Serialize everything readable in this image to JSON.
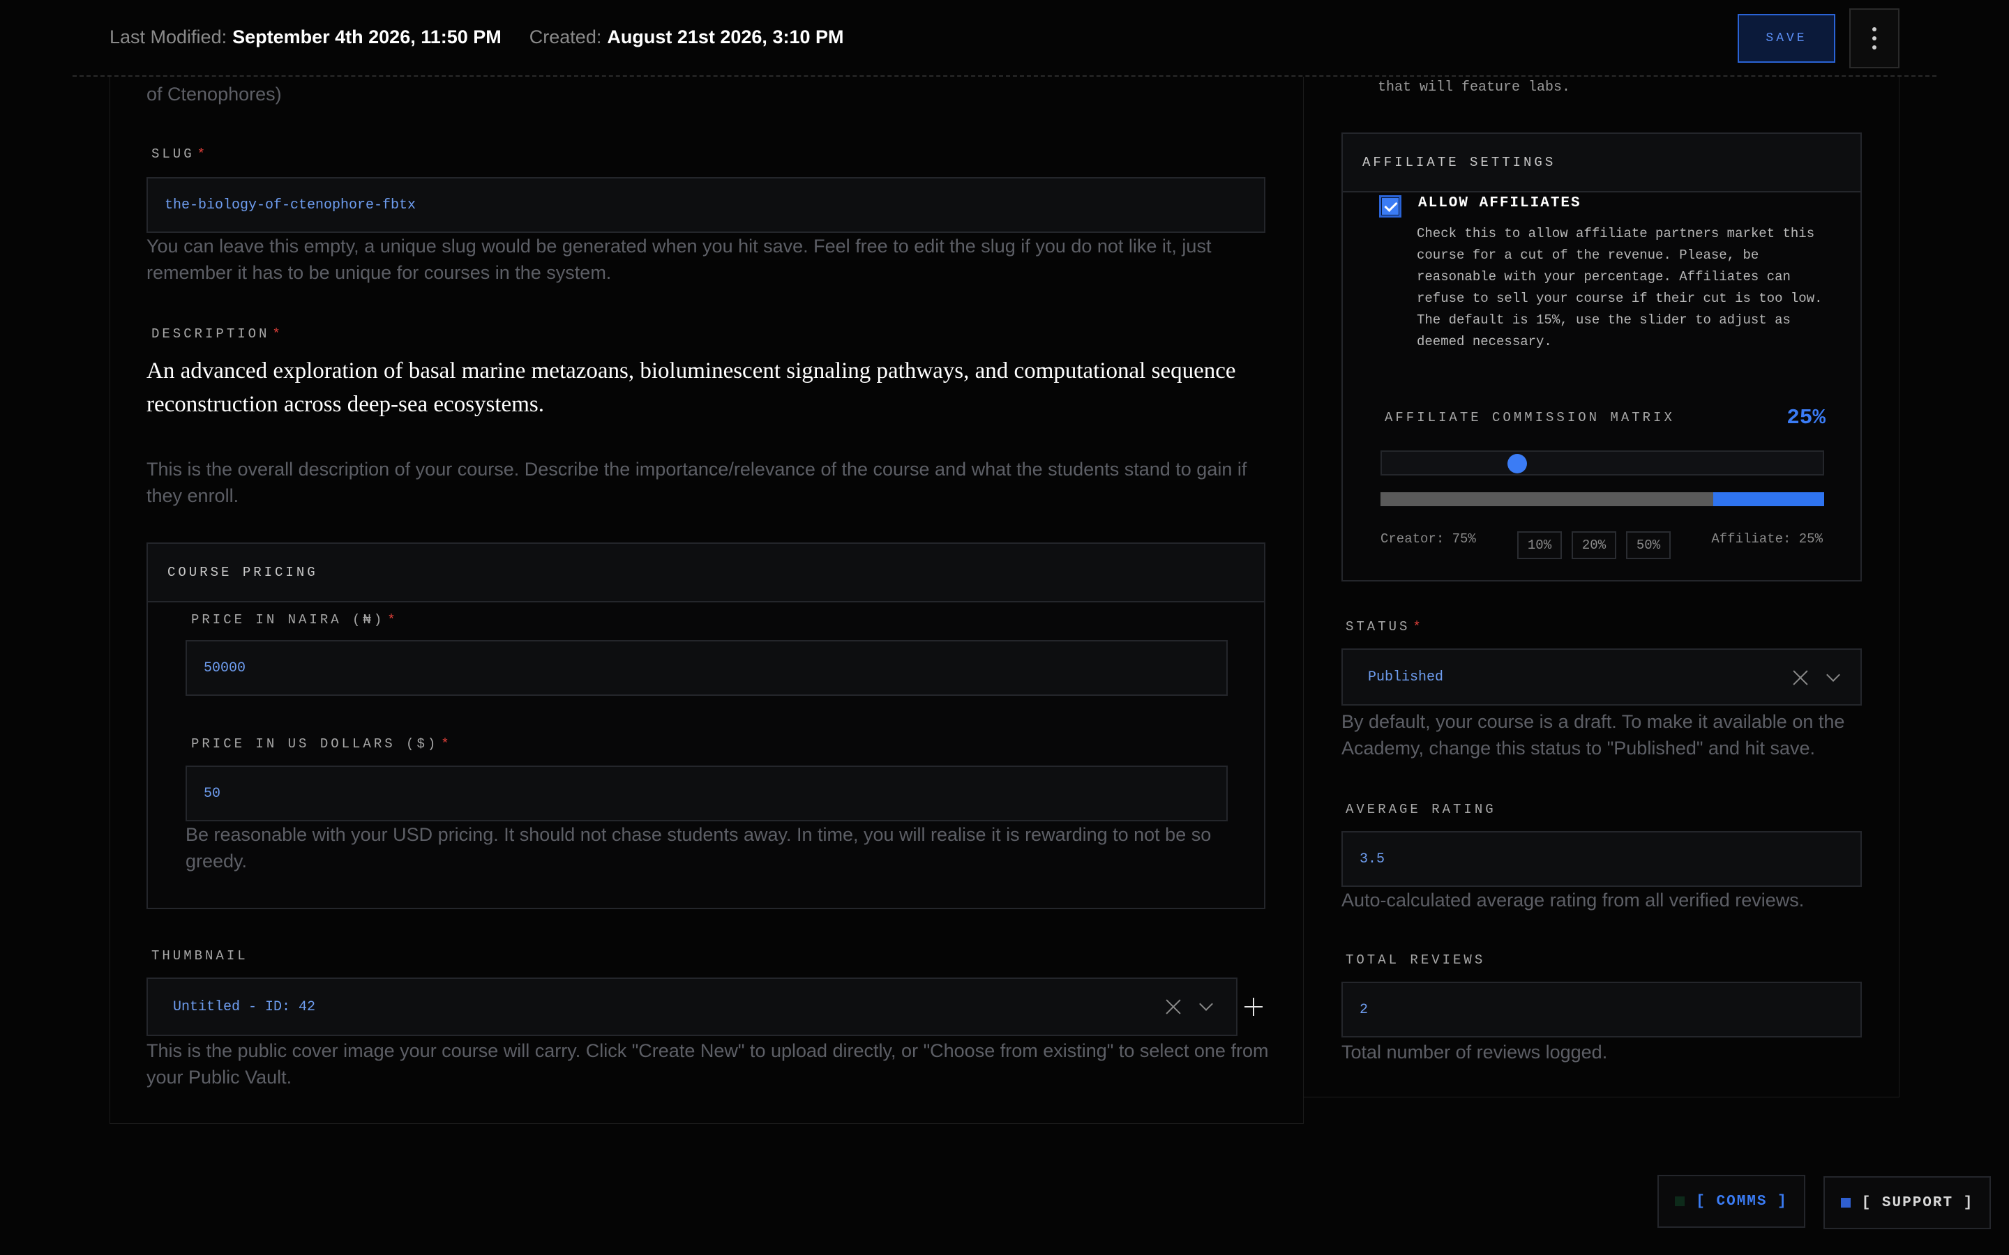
{
  "header": {
    "last_modified_label": "Last Modified:",
    "last_modified_value": "September 4th 2026, 11:50 PM",
    "created_label": "Created:",
    "created_value": "August 21st 2026, 3:10 PM",
    "save_label": "SAVE"
  },
  "left": {
    "title_overflow": "of Ctenophores)",
    "slug": {
      "label": "SLUG",
      "value": "the-biology-of-ctenophore-fbtx",
      "help": "You can leave this empty, a unique slug would be generated when you hit save. Feel free to edit the slug if you do not like it, just remember it has to be unique for courses in the system."
    },
    "description": {
      "label": "DESCRIPTION",
      "value": "An advanced exploration of basal marine metazoans, bioluminescent signaling pathways, and computational sequence reconstruction across deep-sea ecosystems.",
      "help": "This is the overall description of your course. Describe the importance/relevance of the course and what the students stand to gain if they enroll."
    },
    "pricing": {
      "title": "COURSE PRICING",
      "naira_label": "PRICE IN NAIRA (₦)",
      "naira_value": "50000",
      "usd_label": "PRICE IN US DOLLARS ($)",
      "usd_value": "50",
      "help": "Be reasonable with your USD pricing. It should not chase students away. In time, you will realise it is rewarding to not be so greedy."
    },
    "thumbnail": {
      "label": "THUMBNAIL",
      "value": "Untitled - ID: 42",
      "help": "This is the public cover image your course will carry. Click \"Create New\" to upload directly, or \"Choose from existing\" to select one from your Public Vault."
    }
  },
  "right": {
    "overflow_text": "that will feature labs.",
    "affiliate": {
      "title": "AFFILIATE SETTINGS",
      "allow_label": "ALLOW AFFILIATES",
      "allow_checked": true,
      "allow_help": "Check this to allow affiliate partners market this course for a cut of the revenue. Please, be reasonable with your percentage. Affiliates can refuse to sell your course if their cut is too low. The default is 15%, use the slider to adjust as deemed necessary.",
      "matrix_label": "AFFILIATE COMMISSION MATRIX",
      "percent_display": "25%",
      "slider_fraction": 0.25,
      "creator_label": "Creator: 75%",
      "affiliate_label": "Affiliate: 25%",
      "presets": [
        "10%",
        "20%",
        "50%"
      ]
    },
    "status": {
      "label": "STATUS",
      "value": "Published",
      "help": "By default, your course is a draft. To make it available on the Academy, change this status to \"Published\" and hit save."
    },
    "rating": {
      "label": "AVERAGE RATING",
      "value": "3.5",
      "help": "Auto-calculated average rating from all verified reviews."
    },
    "reviews": {
      "label": "TOTAL REVIEWS",
      "value": "2",
      "help": "Total number of reviews logged."
    }
  },
  "dock": {
    "comms_label": "[ COMMS ]",
    "support_label": "[ SUPPORT ]"
  },
  "colors": {
    "accent": "#3b7cf5",
    "required": "#e0403a",
    "background": "#050505"
  }
}
